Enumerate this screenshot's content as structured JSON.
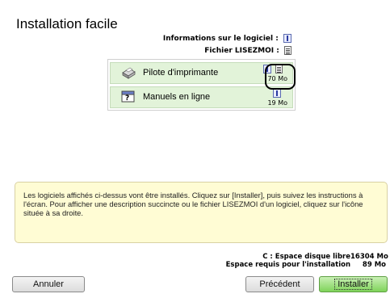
{
  "page": {
    "title": "Installation facile"
  },
  "info": {
    "software_info_label": "Informations sur le logiciel :",
    "readme_label": "Fichier LISEZMOI :"
  },
  "list": {
    "items": [
      {
        "label": "Pilote d'imprimante",
        "size": "70 Mo",
        "icon": "printer-icon"
      },
      {
        "label": "Manuels en ligne",
        "size": "19 Mo",
        "icon": "manual-book-icon"
      }
    ]
  },
  "message": "Les logiciels affichés ci-dessus vont être installés. Cliquez sur [Installer], puis suivez les instructions à l'écran. Pour afficher une description succincte ou le fichier LISEZMOI d'un logiciel, cliquez sur l'icône située à sa droite.",
  "disk": {
    "free_label": "C : Espace disque libre",
    "free_value": "16304 Mo",
    "required_label": "Espace requis pour l'installation",
    "required_value": "89 Mo"
  },
  "buttons": {
    "cancel": "Annuler",
    "previous": "Précédent",
    "install": "Installer"
  },
  "colors": {
    "row_bg": "#e2f3d9",
    "message_bg": "#fffcd4",
    "install_button": "#7fd35a"
  }
}
